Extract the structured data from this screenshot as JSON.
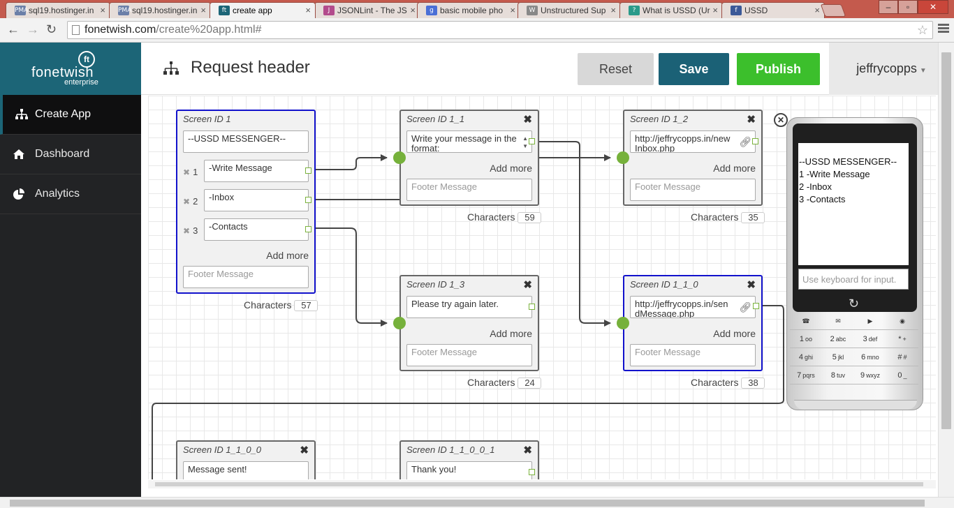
{
  "browser": {
    "tabs": [
      {
        "title": "sql19.hostinger.in",
        "favicon": "PMA",
        "color": "#6b7fa8"
      },
      {
        "title": "sql19.hostinger.in",
        "favicon": "PMA",
        "color": "#6b7fa8"
      },
      {
        "title": "create app",
        "favicon": "ft",
        "color": "#1c6577"
      },
      {
        "title": "JSONLint - The JS",
        "favicon": "J",
        "color": "#b34b8c"
      },
      {
        "title": "basic mobile pho",
        "favicon": "g",
        "color": "#4a6fd6"
      },
      {
        "title": "Unstructured Sup",
        "favicon": "W",
        "color": "#888888"
      },
      {
        "title": "What is USSD (Ur",
        "favicon": "?",
        "color": "#2a9a8a"
      },
      {
        "title": "USSD",
        "favicon": "f",
        "color": "#3b5998"
      }
    ],
    "url_host": "fonetwish.com",
    "url_path": "/create%20app.html#"
  },
  "sidebar": {
    "brand": "fonetwish",
    "brand_mark": "ft",
    "brand_sub": "enterprise",
    "items": [
      {
        "label": "Create App",
        "icon": "sitemap-icon"
      },
      {
        "label": "Dashboard",
        "icon": "home-icon"
      },
      {
        "label": "Analytics",
        "icon": "pie-chart-icon"
      }
    ]
  },
  "header": {
    "title": "Request header",
    "reset": "Reset",
    "save": "Save",
    "publish": "Publish",
    "user": "jeffrycopps"
  },
  "nodes": {
    "n1": {
      "title": "Screen ID 1",
      "header": "--USSD MESSENGER--",
      "options": [
        {
          "num": "1",
          "text": "-Write Message"
        },
        {
          "num": "2",
          "text": "-Inbox"
        },
        {
          "num": "3",
          "text": "-Contacts"
        }
      ],
      "add_more": "Add more",
      "footer_placeholder": "Footer Message",
      "chars_label": "Characters",
      "chars": "57"
    },
    "n1_1": {
      "title": "Screen ID 1_1",
      "header": "Write your message in the format:",
      "add_more": "Add more",
      "footer_placeholder": "Footer Message",
      "chars_label": "Characters",
      "chars": "59"
    },
    "n1_2": {
      "title": "Screen ID 1_2",
      "header": "http://jeffrycopps.in/new Inbox.php",
      "add_more": "Add more",
      "footer_placeholder": "Footer Message",
      "chars_label": "Characters",
      "chars": "35"
    },
    "n1_3": {
      "title": "Screen ID 1_3",
      "header": "Please try again later.",
      "add_more": "Add more",
      "footer_placeholder": "Footer Message",
      "chars_label": "Characters",
      "chars": "24"
    },
    "n1_1_0": {
      "title": "Screen ID 1_1_0",
      "header": "http://jeffrycopps.in/sen dMessage.php",
      "add_more": "Add more",
      "footer_placeholder": "Footer Message",
      "chars_label": "Characters",
      "chars": "38"
    },
    "n1_1_0_0": {
      "title": "Screen ID 1_1_0_0",
      "header": "Message sent!"
    },
    "n1_1_0_0_1": {
      "title": "Screen ID 1_1_0_0_1",
      "header": "Thank you!"
    }
  },
  "phone": {
    "screen_lines": [
      "--USSD MESSENGER--",
      "1 -Write Message",
      "2 -Inbox",
      "3 -Contacts"
    ],
    "input_placeholder": "Use keyboard for input.",
    "keys": [
      {
        "digit": "1",
        "letters": "oo"
      },
      {
        "digit": "2",
        "letters": "abc"
      },
      {
        "digit": "3",
        "letters": "def"
      },
      {
        "digit": "*",
        "letters": "+"
      },
      {
        "digit": "4",
        "letters": "ghi"
      },
      {
        "digit": "5",
        "letters": "jkl"
      },
      {
        "digit": "6",
        "letters": "mno"
      },
      {
        "digit": "#",
        "letters": "#"
      },
      {
        "digit": "7",
        "letters": "pqrs"
      },
      {
        "digit": "8",
        "letters": "tuv"
      },
      {
        "digit": "9",
        "letters": "wxyz"
      },
      {
        "digit": "0",
        "letters": "_"
      }
    ]
  },
  "colors": {
    "brand": "#1c6577",
    "save": "#1b6176",
    "publish": "#3cbf2c",
    "selected_border": "#1212cc",
    "port": "#76b13b"
  }
}
